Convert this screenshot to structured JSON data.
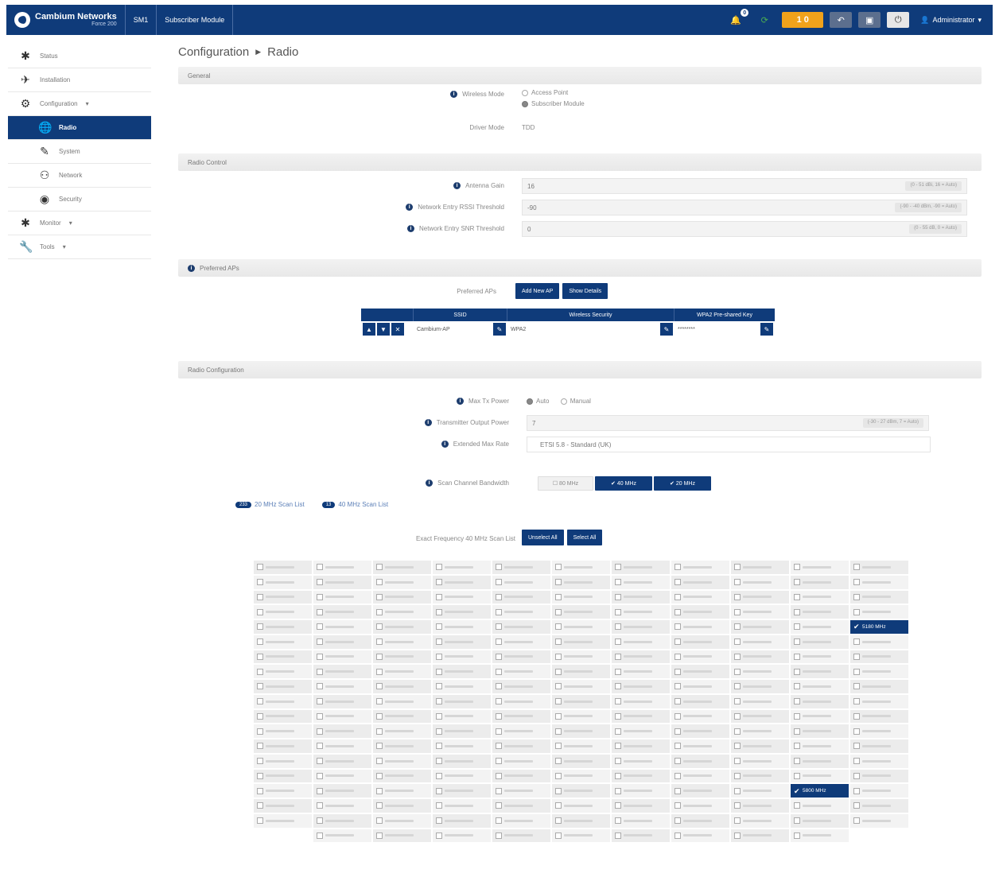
{
  "header": {
    "brand": "Cambium Networks",
    "product": "Force 200",
    "mode_short": "SM1",
    "device_type": "Subscriber Module",
    "alert_count": "0",
    "orange_label": "1 0",
    "admin_label": "Administrator"
  },
  "sidebar": {
    "items": [
      {
        "label": "Status",
        "icon": "status-icon"
      },
      {
        "label": "Installation",
        "icon": "installation-icon"
      },
      {
        "label": "Configuration",
        "icon": "gear-icon"
      },
      {
        "label": "Radio",
        "icon": "globe-icon"
      },
      {
        "label": "System",
        "icon": "edit-icon"
      },
      {
        "label": "Network",
        "icon": "network-icon"
      },
      {
        "label": "Security",
        "icon": "security-icon"
      },
      {
        "label": "Monitor",
        "icon": "monitor-icon"
      },
      {
        "label": "Tools",
        "icon": "wrench-icon"
      }
    ]
  },
  "page": {
    "section": "Configuration",
    "title": "Radio"
  },
  "general": {
    "heading": "General",
    "wireless_mode_label": "Wireless Mode",
    "mode_options": [
      "Access Point",
      "Subscriber Module"
    ],
    "mode_selected": "Subscriber Module",
    "driver_mode_label": "Driver Mode",
    "driver_mode_value": "TDD"
  },
  "radio_control": {
    "heading": "Radio Control",
    "fields": [
      {
        "label": "Antenna Gain",
        "value": "16",
        "range": "(0 - 51 dBi, 16 = Auto)"
      },
      {
        "label": "Network Entry RSSI Threshold",
        "value": "-90",
        "range": "(-90 - -40 dBm, -90 = Auto)"
      },
      {
        "label": "Network Entry SNR Threshold",
        "value": "0",
        "range": "(0 - 55 dB, 0 = Auto)"
      }
    ]
  },
  "preferred_aps": {
    "heading": "Preferred APs",
    "label": "Preferred APs",
    "add_button": "Add New AP",
    "details_button": "Show Details",
    "columns": [
      "SSID",
      "Wireless Security",
      "WPA2 Pre-shared Key"
    ],
    "rows": [
      {
        "ssid": "Cambium-AP",
        "security": "WPA2",
        "key": "********"
      }
    ]
  },
  "radio_config": {
    "heading": "Radio Configuration",
    "max_tx_label": "Max Tx Power",
    "max_tx_options": [
      "Auto",
      "Manual"
    ],
    "max_tx_selected": "Auto",
    "eirp_label": "Transmitter Output Power",
    "eirp_value": "7",
    "eirp_range": "(-30 - 27 dBm, 7 = Auto)",
    "cc_label": "Extended Max Rate",
    "cc_value": "ETSI 5.8 - Standard (UK)",
    "scan_bw_label": "Scan Channel Bandwidth",
    "scan_bw_options": [
      {
        "label": "80 MHz",
        "checked": false
      },
      {
        "label": "40 MHz",
        "checked": true
      },
      {
        "label": "20 MHz",
        "checked": true
      }
    ],
    "tabs": [
      {
        "badge": "233",
        "label": "20 MHz Scan List"
      },
      {
        "badge": "13",
        "label": "40 MHz Scan List"
      }
    ],
    "freq_list_label": "Exact Frequency 40 MHz Scan List",
    "unselect_all": "Unselect All",
    "select_all": "Select All",
    "selected_freqs": [
      "5180 MHz",
      "5800 MHz"
    ]
  }
}
